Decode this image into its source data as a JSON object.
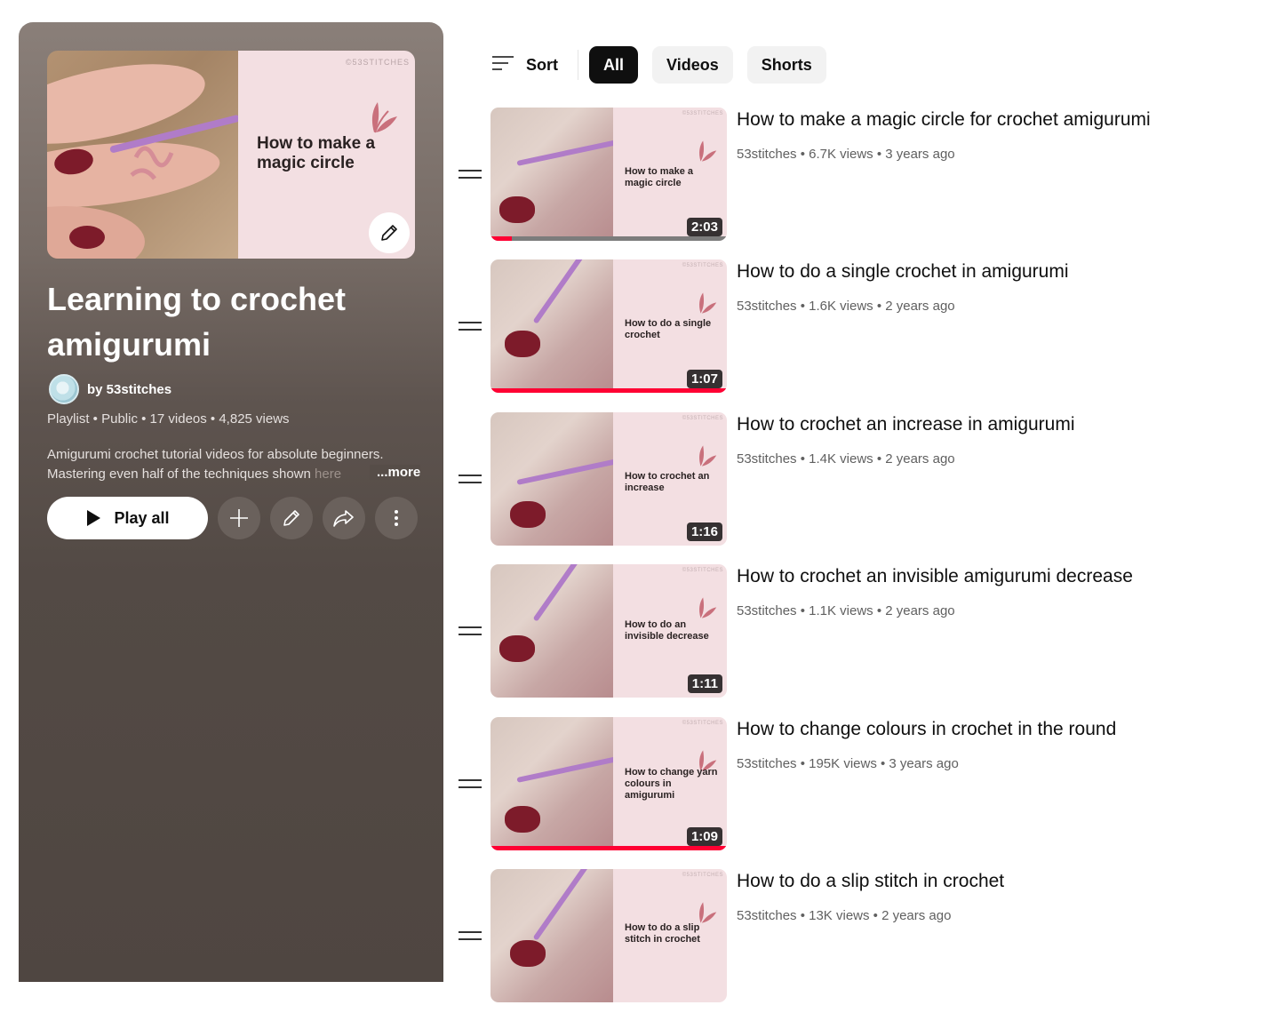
{
  "playlist": {
    "thumbnail": {
      "brand": "©53STITCHES",
      "title": "How to make a magic circle"
    },
    "title": "Learning to crochet amigurumi",
    "owner": "by 53stitches",
    "meta": "Playlist • Public • 17 videos • 4,825 views",
    "description_visible": "Amigurumi crochet tutorial videos for absolute beginners. Mastering even half of the techniques shown",
    "description_faded": "here",
    "more_label": "...more",
    "play_all_label": "Play all",
    "icons": [
      "edit-icon",
      "play-icon",
      "add-icon",
      "edit-icon",
      "share-icon",
      "more-vert-icon"
    ]
  },
  "filters": {
    "sort_label": "Sort",
    "chips": [
      "All",
      "Videos",
      "Shorts"
    ],
    "active_chip": "All"
  },
  "videos": [
    {
      "title": "How to make a magic circle for crochet amigurumi",
      "meta": "53stitches • 6.7K views • 3 years ago",
      "duration": "2:03",
      "thumb_text": "How to make a magic circle",
      "progress": 0.09
    },
    {
      "title": "How to do a single crochet in amigurumi",
      "meta": "53stitches • 1.6K views • 2 years ago",
      "duration": "1:07",
      "thumb_text": "How to do a single crochet",
      "progress": 1.0
    },
    {
      "title": "How to crochet an increase in amigurumi",
      "meta": "53stitches • 1.4K views • 2 years ago",
      "duration": "1:16",
      "thumb_text": "How to crochet an increase",
      "progress": 0
    },
    {
      "title": "How to crochet an invisible amigurumi decrease",
      "meta": "53stitches • 1.1K views • 2 years ago",
      "duration": "1:11",
      "thumb_text": "How to do an invisible decrease",
      "progress": 0
    },
    {
      "title": "How to change colours in crochet in the round",
      "meta": "53stitches • 195K views • 3 years ago",
      "duration": "1:09",
      "thumb_text": "How to change yarn colours in amigurumi",
      "progress": 1.0
    },
    {
      "title": "How to do a slip stitch in crochet",
      "meta": "53stitches • 13K views • 2 years ago",
      "duration": "",
      "thumb_text": "How to do a slip stitch in crochet",
      "progress": 0
    }
  ],
  "colors": {
    "accent": "#ff0033",
    "panel": "#534a45",
    "thumb_card": "#f3dfe2",
    "brand_leaf": "#c9707c"
  }
}
